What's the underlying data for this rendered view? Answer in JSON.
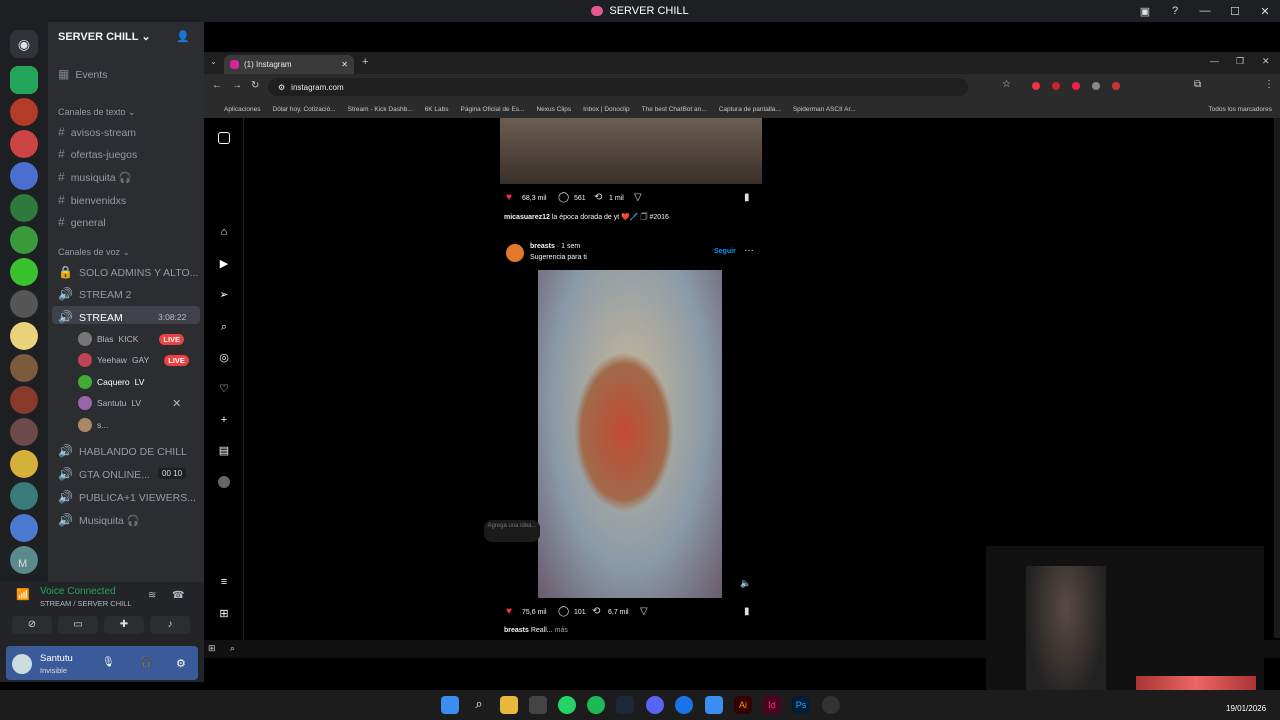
{
  "window_title": "SERVER CHILL",
  "discord": {
    "server_name": "SERVER CHILL",
    "events": "Events",
    "text_category": "Canales de texto",
    "text_channels": [
      "avisos-stream",
      "ofertas-juegos",
      "musiquita 🎧",
      "bienvenidxs",
      "general"
    ],
    "voice_category": "Canales de voz",
    "voice_channels": [
      "SOLO ADMINS Y ALTO...",
      "STREAM 2",
      "STREAM",
      "HABLANDO DE CHILL",
      "GTA ONLINE...",
      "PUBLICA+1 VIEWERS...",
      "Musiquita 🎧"
    ],
    "stream_timer": "3:08:22",
    "gta_counts": "00 10",
    "voice_users": [
      {
        "name": "Blas",
        "extra": "KICK",
        "live": "LIVE"
      },
      {
        "name": "Yeehaw",
        "extra": "GAY",
        "live": "LIVE"
      },
      {
        "name": "Caquero",
        "extra": "LV",
        "live": ""
      },
      {
        "name": "Santutu",
        "extra": "LV",
        "live": ""
      },
      {
        "name": "s...",
        "extra": "",
        "live": ""
      }
    ],
    "voice_status": "Voice Connected",
    "voice_sub": "STREAM / SERVER CHILL",
    "user_name": "Santutu",
    "user_status": "Invisible",
    "rail_letter": "M"
  },
  "browser": {
    "tab_title": "(1) Instagram",
    "url": "instagram.com",
    "bookmarks": [
      "Aplicaciones",
      "Dólar hoy, Cotizació...",
      "Stream - Kick Dashb...",
      "6K Labs",
      "Página Oficial de Es...",
      "Nexus Clips",
      "Inbox | Donoclip",
      "The best ChatBot an...",
      "Captura de pantalla...",
      "Spiderman ASCII Ar..."
    ],
    "all_bookmarks": "Todos los marcadores"
  },
  "instagram": {
    "post1": {
      "likes": "68,3 mil",
      "comments": "561",
      "reposts": "1 mil",
      "caption_user": "micasuarez12",
      "caption_text": "la época dorada de yt ❤️🖊️ 🗍 #2016"
    },
    "post2": {
      "user": "breasts",
      "time": "1 sem",
      "sub": "Sugerencia para ti",
      "follow": "Seguir",
      "likes": "75,6 mil",
      "comments": "101",
      "reposts": "6,7 mil",
      "caption_user": "breasts",
      "caption_text": "Reall...",
      "more": "más"
    },
    "bubble": "Agrega una idea..."
  },
  "system": {
    "time": "19/01/2026"
  }
}
